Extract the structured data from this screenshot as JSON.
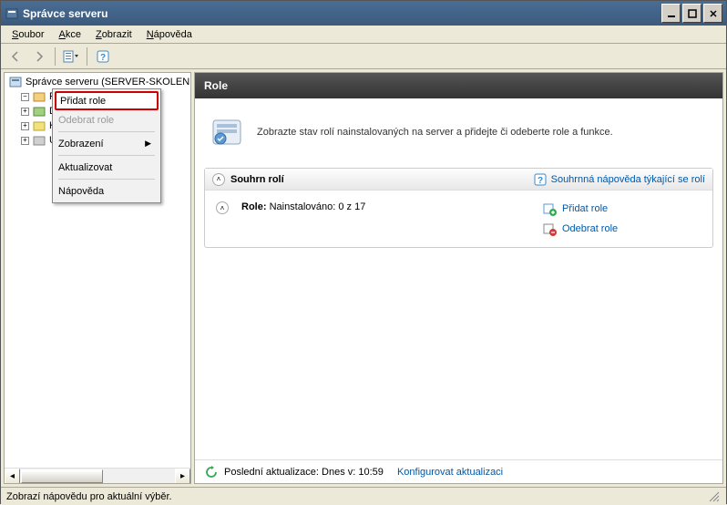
{
  "window": {
    "title": "Správce serveru"
  },
  "menu": {
    "soubor": "Soubor",
    "akce": "Akce",
    "zobrazit": "Zobrazit",
    "napoveda": "Nápověda"
  },
  "tree": {
    "root": "Správce serveru (SERVER-SKOLENI",
    "items": [
      "F",
      "D",
      "K",
      "Ú"
    ]
  },
  "contextmenu": {
    "add_roles": "Přidat role",
    "remove_roles": "Odebrat role",
    "view": "Zobrazení",
    "refresh": "Aktualizovat",
    "help": "Nápověda"
  },
  "content": {
    "header": "Role",
    "intro": "Zobrazte stav rolí nainstalovaných na server a přidejte či odeberte role a funkce.",
    "section_title": "Souhrn rolí",
    "help_link": "Souhrnná nápověda týkající se rolí",
    "roles_label": "Role:",
    "roles_status": "Nainstalováno: 0 z 17",
    "action_add": "Přidat role",
    "action_remove": "Odebrat role"
  },
  "footer": {
    "last_update_label": "Poslední aktualizace: Dnes v: 10:59",
    "configure": "Konfigurovat aktualizaci"
  },
  "statusbar": {
    "text": "Zobrazí nápovědu pro aktuální výběr."
  }
}
